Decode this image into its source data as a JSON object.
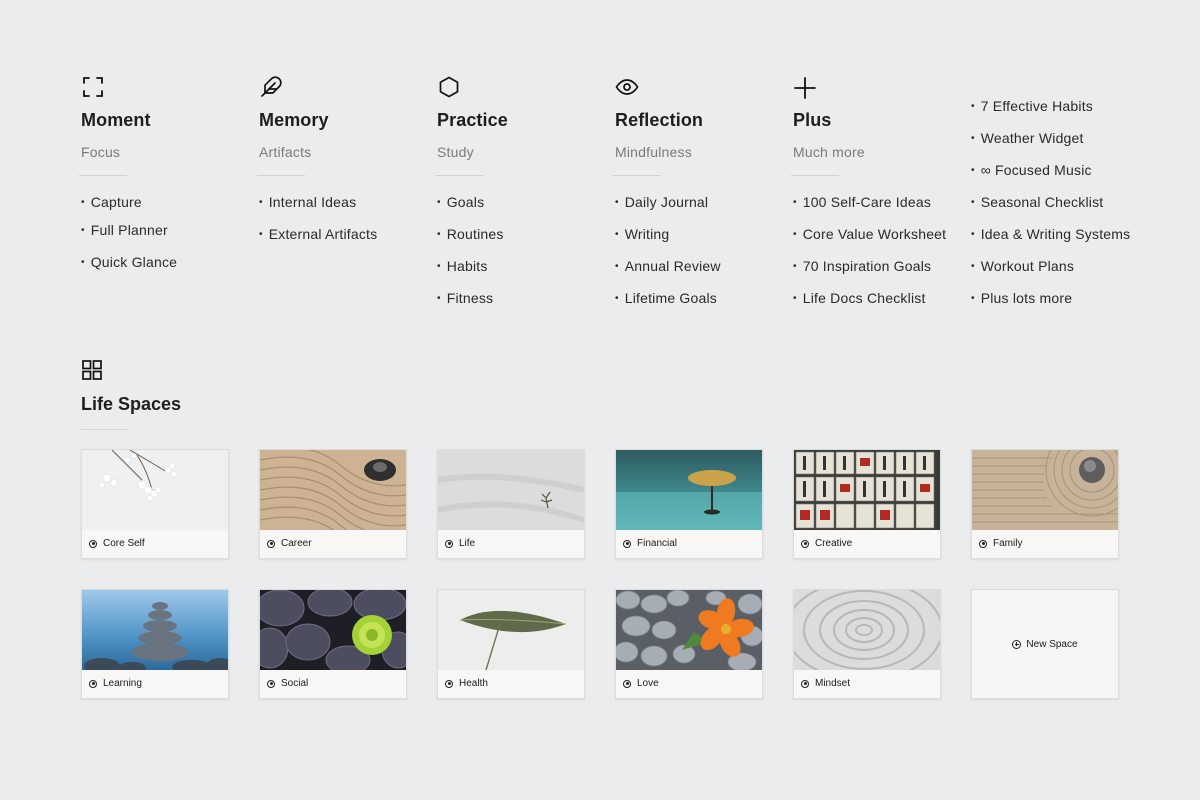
{
  "columns": [
    {
      "title": "Moment",
      "subtitle": "Focus",
      "icon": "focus-frame-icon",
      "items": [
        "Capture",
        "Full Planner",
        "Quick Glance"
      ]
    },
    {
      "title": "Memory",
      "subtitle": "Artifacts",
      "icon": "feather-icon",
      "items": [
        "Internal Ideas",
        "External Artifacts"
      ]
    },
    {
      "title": "Practice",
      "subtitle": "Study",
      "icon": "hexagon-icon",
      "items": [
        "Goals",
        "Routines",
        "Habits",
        "Fitness"
      ]
    },
    {
      "title": "Reflection",
      "subtitle": "Mindfulness",
      "icon": "eye-icon",
      "items": [
        "Daily Journal",
        "Writing",
        "Annual Review",
        "Lifetime Goals"
      ]
    },
    {
      "title": "Plus",
      "subtitle": "Much more",
      "icon": "plus-icon",
      "items": [
        "100 Self-Care Ideas",
        "Core Value Worksheet",
        "70 Inspiration Goals",
        "Life Docs Checklist"
      ]
    }
  ],
  "extras": {
    "items": [
      "7 Effective Habits",
      "Weather Widget",
      "∞ Focused Music",
      "Seasonal Checklist",
      "Idea & Writing Systems",
      "Workout Plans",
      "Plus lots more"
    ]
  },
  "life_spaces": {
    "title": "Life Spaces",
    "icon": "grid-icon",
    "cards": [
      {
        "label": "Core Self",
        "image": "cherry-blossom"
      },
      {
        "label": "Career",
        "image": "zen-sand-stone"
      },
      {
        "label": "Life",
        "image": "sand-sprout"
      },
      {
        "label": "Financial",
        "image": "tree-in-water"
      },
      {
        "label": "Creative",
        "image": "sake-barrels"
      },
      {
        "label": "Family",
        "image": "sand-circles-stone"
      },
      {
        "label": "Learning",
        "image": "stacked-stones"
      },
      {
        "label": "Social",
        "image": "pebbles-flower"
      },
      {
        "label": "Health",
        "image": "leaf"
      },
      {
        "label": "Love",
        "image": "stones-orange-flower"
      },
      {
        "label": "Mindset",
        "image": "sand-spiral"
      }
    ],
    "new_space_label": "New Space"
  },
  "colors": {
    "background": "#ebecee",
    "card": "#f8f7f5",
    "text": "#1e1e1e",
    "muted": "#7a7a7a"
  }
}
